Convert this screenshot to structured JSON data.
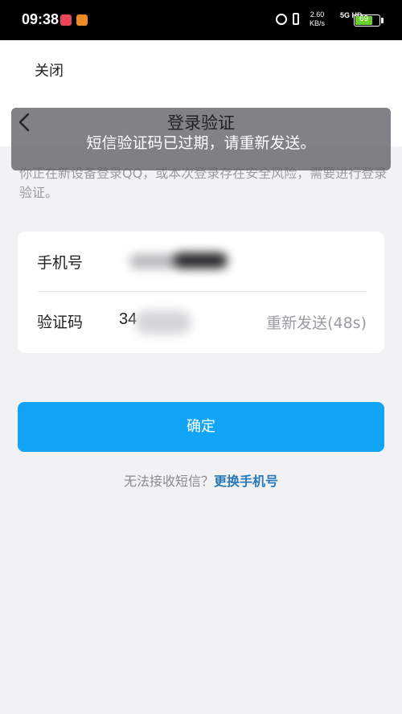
{
  "status_bar": {
    "time": "09:38",
    "net_speed_value": "2.60",
    "net_speed_unit": "KB/s",
    "signal": "5G HD",
    "battery": "69",
    "battery_level": 0.69,
    "battery_color": "#6ad02d"
  },
  "topbar": {
    "close_label": "关闭"
  },
  "header": {
    "title": "登录验证"
  },
  "toast": {
    "text": "短信验证码已过期，请重新发送。"
  },
  "notice": {
    "text": "你正在新设备登录QQ，或本次登录存在安全风险，需要进行登录验证。"
  },
  "form": {
    "phone_label": "手机号",
    "code_label": "验证码",
    "code_value": "34",
    "resend_label": "重新发送(48s)"
  },
  "confirm_button": {
    "label": "确定",
    "color": "#12a5f5"
  },
  "footer": {
    "question": "无法接收短信？",
    "link": "更换手机号",
    "link_color": "#2979b8"
  }
}
